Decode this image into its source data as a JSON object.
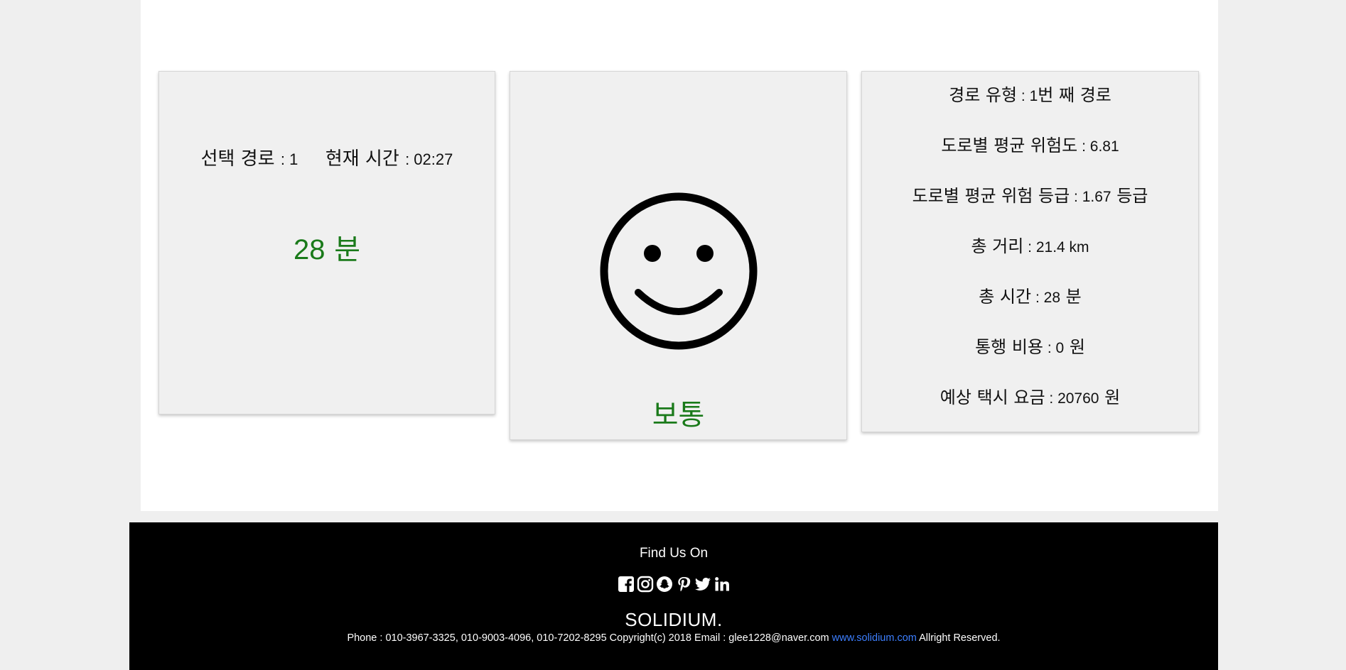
{
  "route_card": {
    "selected_route_label": "선택 경로",
    "selected_route_value": ": 1",
    "current_time_label": "현재 시간",
    "current_time_value": ": 02:27",
    "minutes_number": "28",
    "minutes_unit": "분"
  },
  "status_card": {
    "icon": "smiley-face-icon",
    "status_label": "보통",
    "status_color": "#1a7a1a"
  },
  "info_card": {
    "rows": [
      {
        "label": "경로 유형",
        "sep": " : ",
        "value": "1",
        "unit": "번 째 경로"
      },
      {
        "label": "도로별 평균 위험도",
        "sep": " : ",
        "value": "6.81",
        "unit": ""
      },
      {
        "label": "도로별 평균 위험 등급",
        "sep": " : ",
        "value": "1.67",
        "unit": " 등급"
      },
      {
        "label": "총 거리",
        "sep": " : ",
        "value": "21.4 km",
        "unit": ""
      },
      {
        "label": "총 시간",
        "sep": " : ",
        "value": "28",
        "unit": " 분"
      },
      {
        "label": "통행 비용",
        "sep": " : ",
        "value": "0",
        "unit": " 원"
      },
      {
        "label": "예상 택시 요금",
        "sep": " : ",
        "value": "20760",
        "unit": " 원"
      }
    ]
  },
  "footer": {
    "find_us": "Find Us On",
    "social_icons": [
      "facebook-icon",
      "instagram-icon",
      "snapchat-icon",
      "pinterest-icon",
      "twitter-icon",
      "linkedin-icon"
    ],
    "brand": "SOLIDIUM.",
    "contact_text": "Phone : 010-3967-3325, 010-9003-4096, 010-7202-8295 Copyright(c) 2018  Email : glee1228@naver.com",
    "website_link": "www.solidium.com",
    "rights_text": "Allright Reserved.",
    "link_color": "#3d7fff"
  }
}
